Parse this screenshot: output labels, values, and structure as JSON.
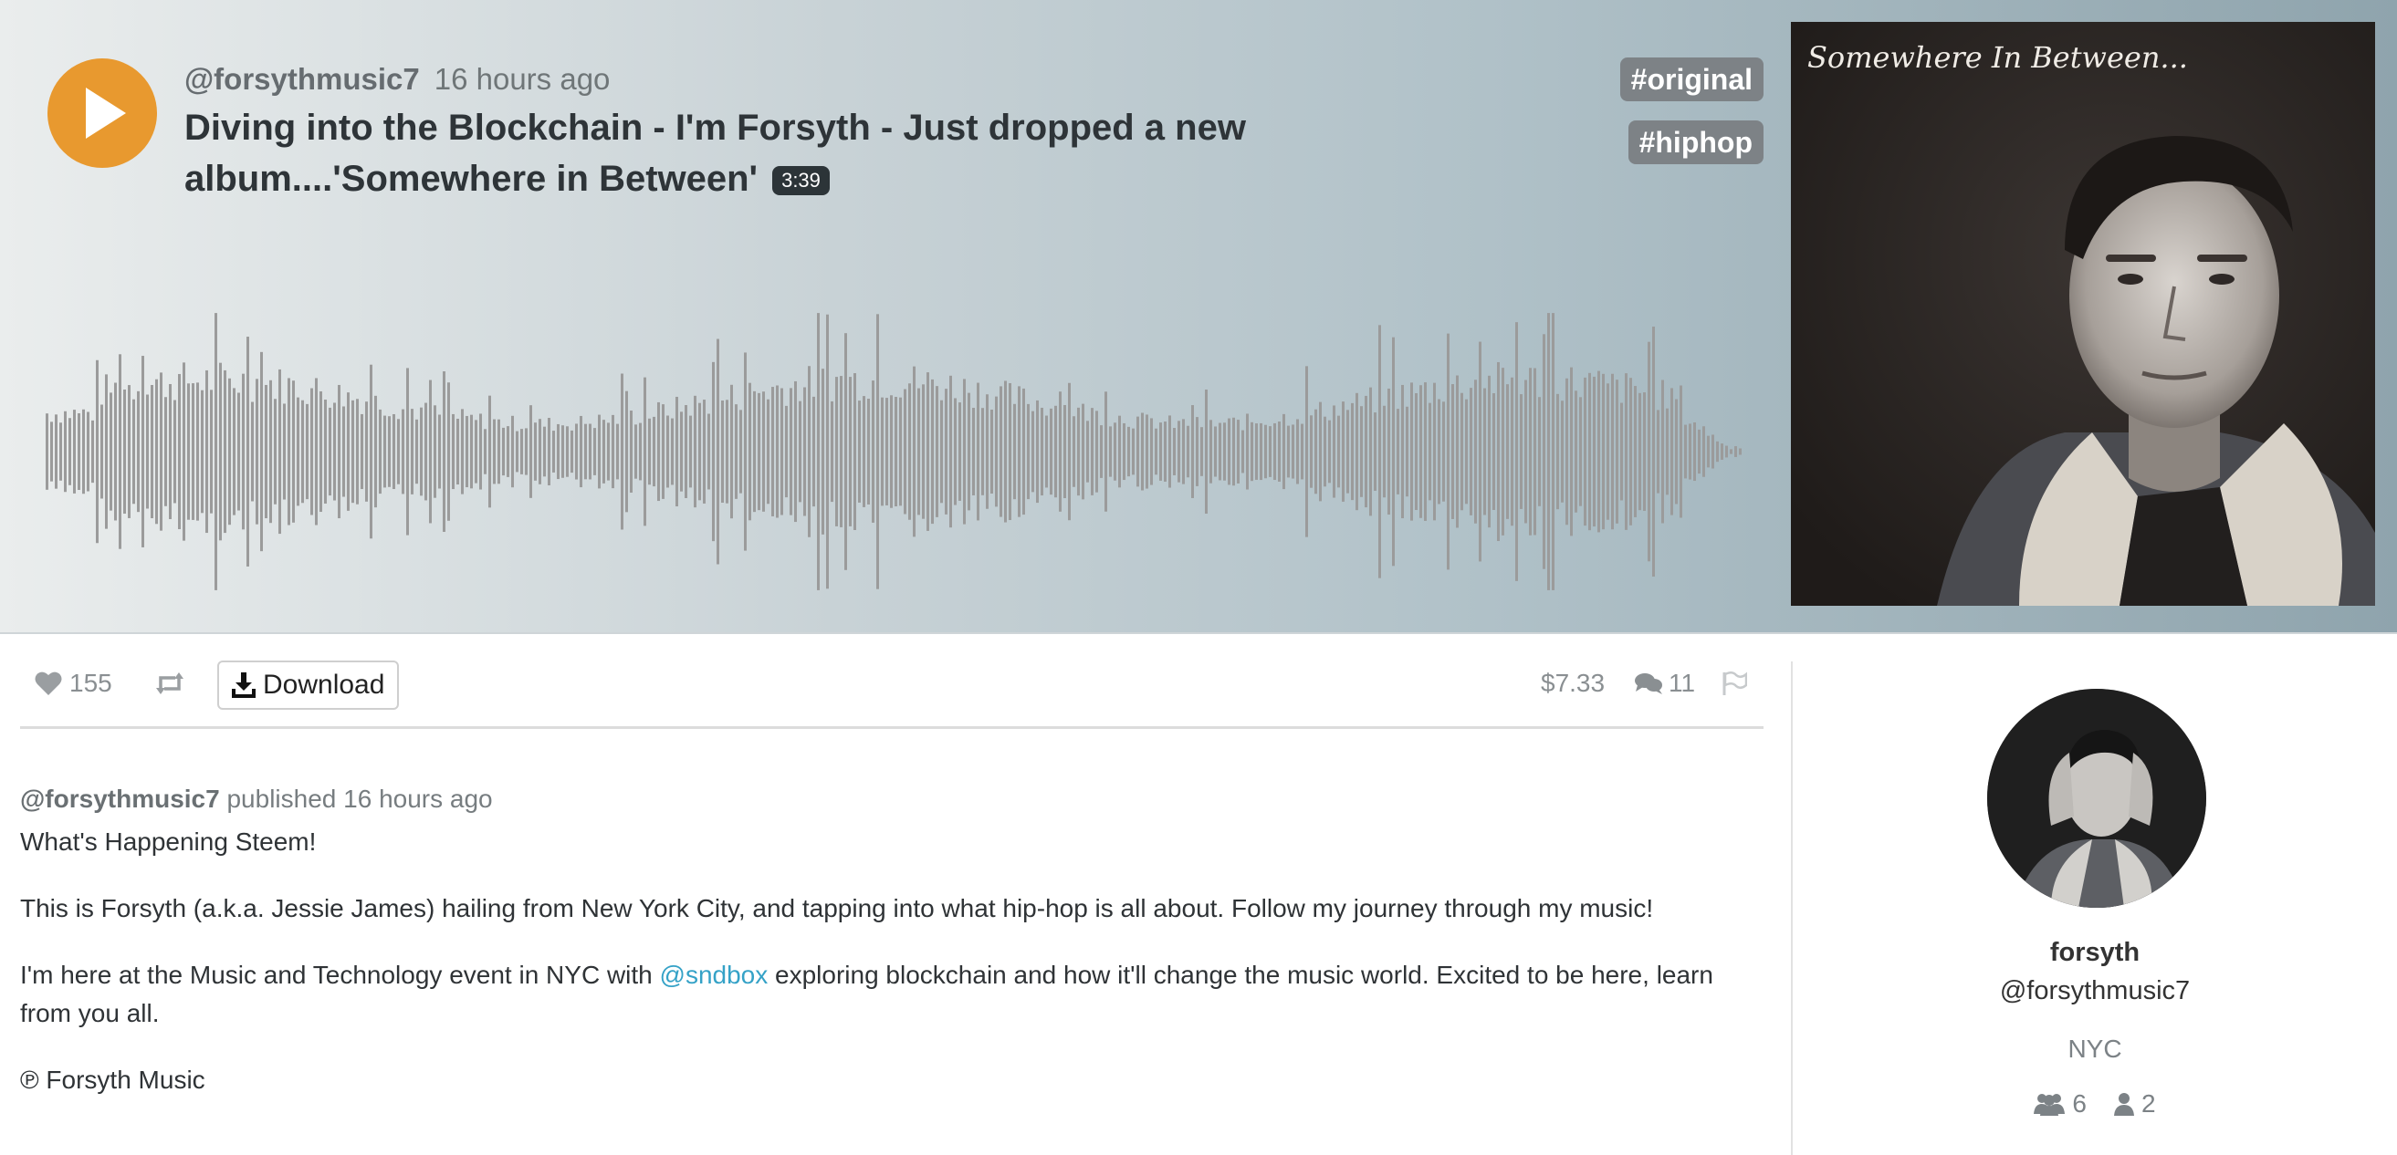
{
  "track": {
    "username": "@forsythmusic7",
    "time_ago": "16 hours ago",
    "title": "Diving into the Blockchain - I'm Forsyth - Just dropped a new album....'Somewhere in Between'",
    "duration": "3:39",
    "tags": [
      "#original",
      "#hiphop"
    ],
    "album_art_text": "Somewhere In Between..."
  },
  "actions": {
    "likes": "155",
    "download_label": "Download",
    "payout": "$7.33",
    "comments": "11"
  },
  "post": {
    "author": "@forsythmusic7",
    "published_text": "published 16 hours ago",
    "paragraph1": "What's Happening Steem!",
    "paragraph2": "This is Forsyth (a.k.a. Jessie James) hailing from New York City, and tapping into what hip-hop is all about. Follow my journey through my music!",
    "paragraph3_before": "I'm here at the Music and Technology event in NYC with ",
    "paragraph3_link": "@sndbox",
    "paragraph3_after": " exploring blockchain and how it'll change the music world. Excited to be here, learn from you all.",
    "paragraph4": "℗ Forsyth Music"
  },
  "profile": {
    "name": "forsyth",
    "handle": "@forsythmusic7",
    "location": "NYC",
    "followers": "6",
    "following": "2"
  },
  "colors": {
    "accent": "#e8992f",
    "tag_bg": "#7d8286",
    "link": "#35a2c7",
    "waveform": "#9b9b9b"
  }
}
